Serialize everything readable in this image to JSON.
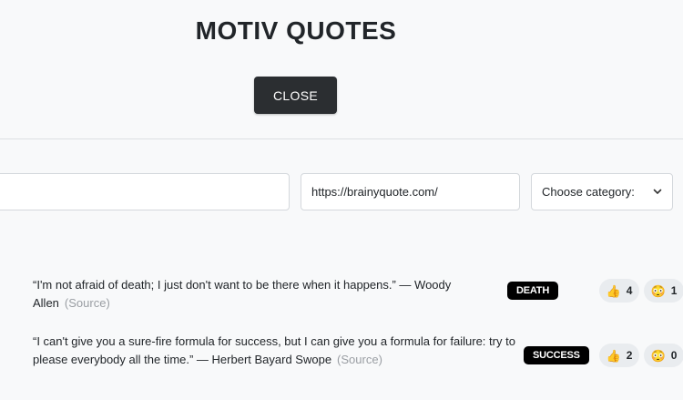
{
  "header": {
    "title": "MOTIV QUOTES",
    "close_label": "CLOSE"
  },
  "form": {
    "quote_value": "",
    "url_value": "https://brainyquote.com/",
    "category_selected": "Choose category:"
  },
  "quotes": [
    {
      "text": "“I'm not afraid of death; I just don't want to be there when it happens.” — Woody Allen",
      "source": "(Source)",
      "category": "DEATH",
      "reaction1_icon": "flexed-hand-icon",
      "reaction1_count": "4",
      "reaction2_icon": "face-icon",
      "reaction2_count": "1"
    },
    {
      "text": "“I can't give you a sure-fire formula for success, but I can give you a formula for failure: try to please everybody all the time.” — Herbert Bayard Swope",
      "source": "(Source)",
      "category": "SUCCESS",
      "reaction1_icon": "flexed-hand-icon",
      "reaction1_count": "2",
      "reaction2_icon": "face-icon",
      "reaction2_count": "0"
    }
  ],
  "colors": {
    "accent": "#2b2e31",
    "badge": "#000000",
    "pill": "#e9ecef"
  }
}
